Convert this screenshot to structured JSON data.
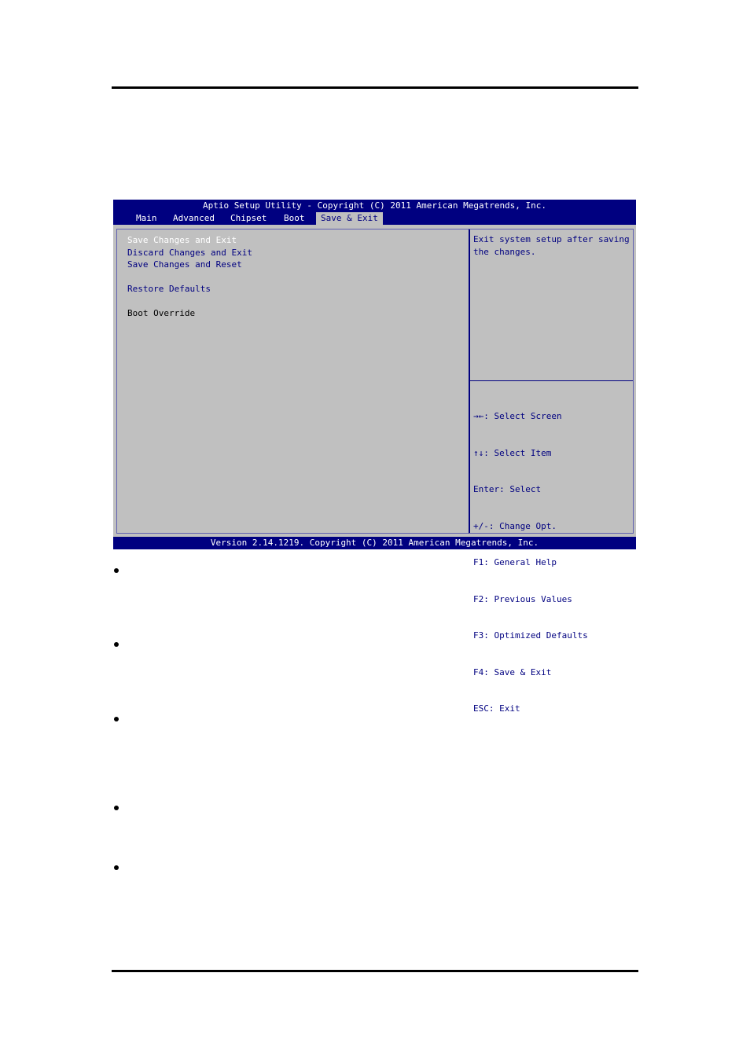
{
  "bios": {
    "title": "Aptio Setup Utility - Copyright (C) 2011 American Megatrends, Inc.",
    "tabs": [
      {
        "label": "Main",
        "active": false
      },
      {
        "label": "Advanced",
        "active": false
      },
      {
        "label": "Chipset",
        "active": false
      },
      {
        "label": "Boot",
        "active": false
      },
      {
        "label": "Save & Exit",
        "active": true
      }
    ],
    "menu": [
      {
        "label": "Save Changes and Exit",
        "state": "selected"
      },
      {
        "label": "Discard Changes and Exit",
        "state": "normal"
      },
      {
        "label": "Save Changes and Reset",
        "state": "normal"
      },
      {
        "label": "Restore Defaults",
        "state": "normal"
      },
      {
        "label": "Boot Override",
        "state": "static"
      }
    ],
    "help_text": "Exit system setup after saving\nthe changes.",
    "keys": [
      "→←: Select Screen",
      "↑↓: Select Item",
      "Enter: Select",
      "+/-: Change Opt.",
      "F1: General Help",
      "F2: Previous Values",
      "F3: Optimized Defaults",
      "F4: Save & Exit",
      "ESC: Exit"
    ],
    "footer": "Version 2.14.1219. Copyright (C) 2011 American Megatrends, Inc.",
    "colors": {
      "header_bg": "#000080",
      "body_bg": "#c0c0c0",
      "selected_text": "#ffffff",
      "item_text": "#000080"
    }
  },
  "bullets_count": 5
}
